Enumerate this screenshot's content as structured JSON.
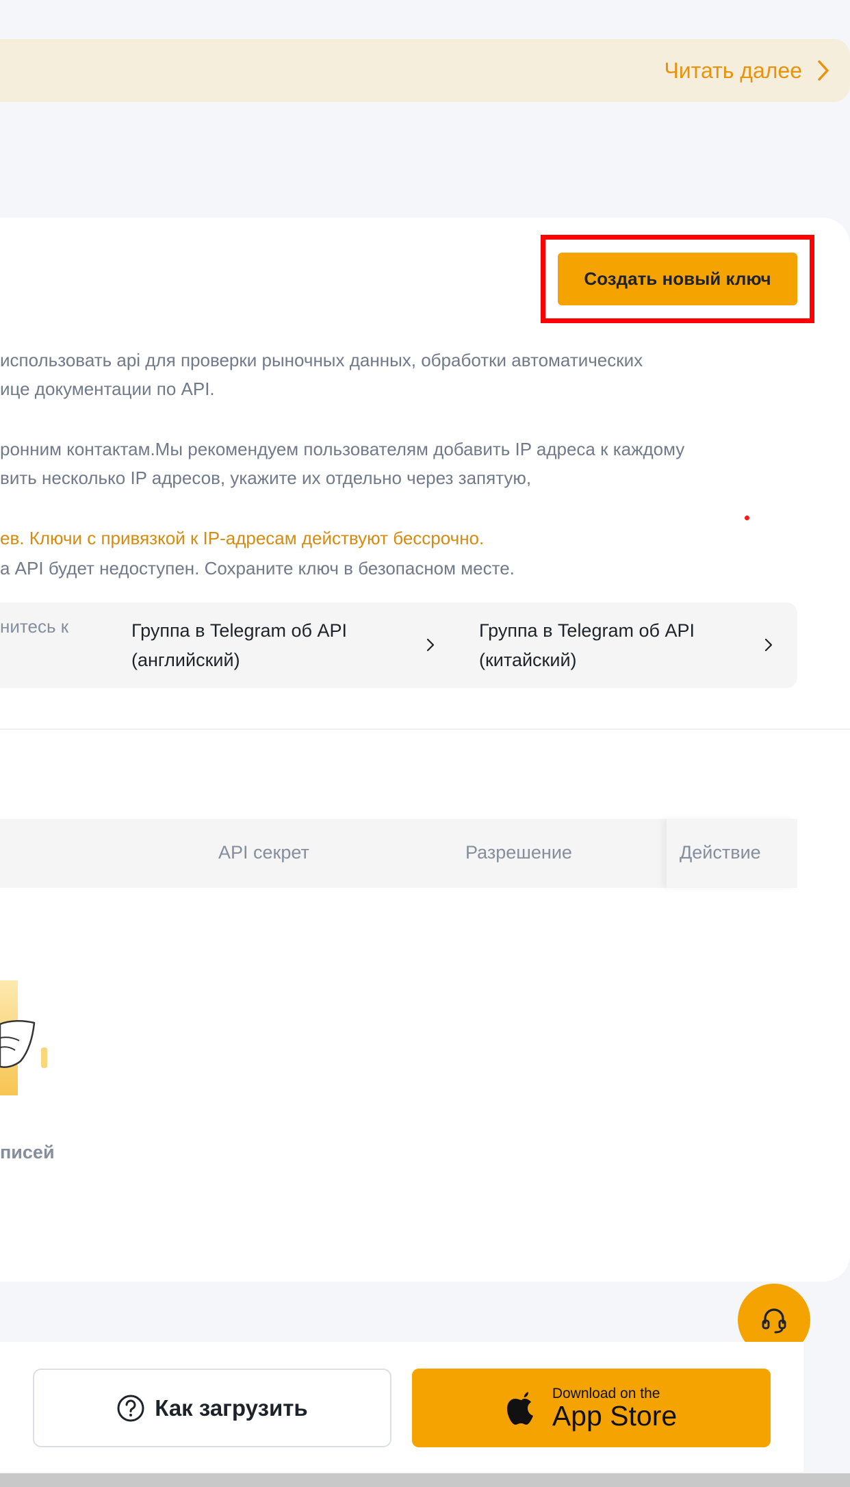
{
  "banner": {
    "read_more": "Читать далее"
  },
  "actions": {
    "create_key": "Создать новый ключ"
  },
  "description": {
    "line1": "использовать api для проверки рыночных данных, обработки автоматических",
    "line2": "ице документации по API.",
    "line3": "ронним контактам.Мы рекомендуем пользователям добавить IP адреса к каждому",
    "line4": "вить несколько IP адресов, укажите их отдельно через запятую,",
    "line5_warning": "ев. Ключи с привязкой к IP-адресам действуют бессрочно.",
    "line6": "а API будет недоступен. Сохраните ключ в безопасном месте."
  },
  "telegram": {
    "partial_label": "нитесь к",
    "groups": [
      {
        "line1": "Группа в Telegram об API",
        "line2": "(английский)"
      },
      {
        "line1": "Группа в Telegram об API",
        "line2": "(китайский)"
      }
    ]
  },
  "table": {
    "columns": [
      "API секрет",
      "Разрешение",
      "Действие"
    ],
    "empty_text": "писей"
  },
  "bottom": {
    "how_to": "Как загрузить",
    "appstore_small": "Download on the",
    "appstore_big": "App Store"
  },
  "colors": {
    "accent": "#f5a300",
    "warning_text": "#d68b10",
    "highlight": "#ff0000"
  },
  "icons": [
    "chevron-right-icon",
    "question-circle-icon",
    "apple-icon",
    "headset-icon",
    "empty-state-illustration"
  ]
}
